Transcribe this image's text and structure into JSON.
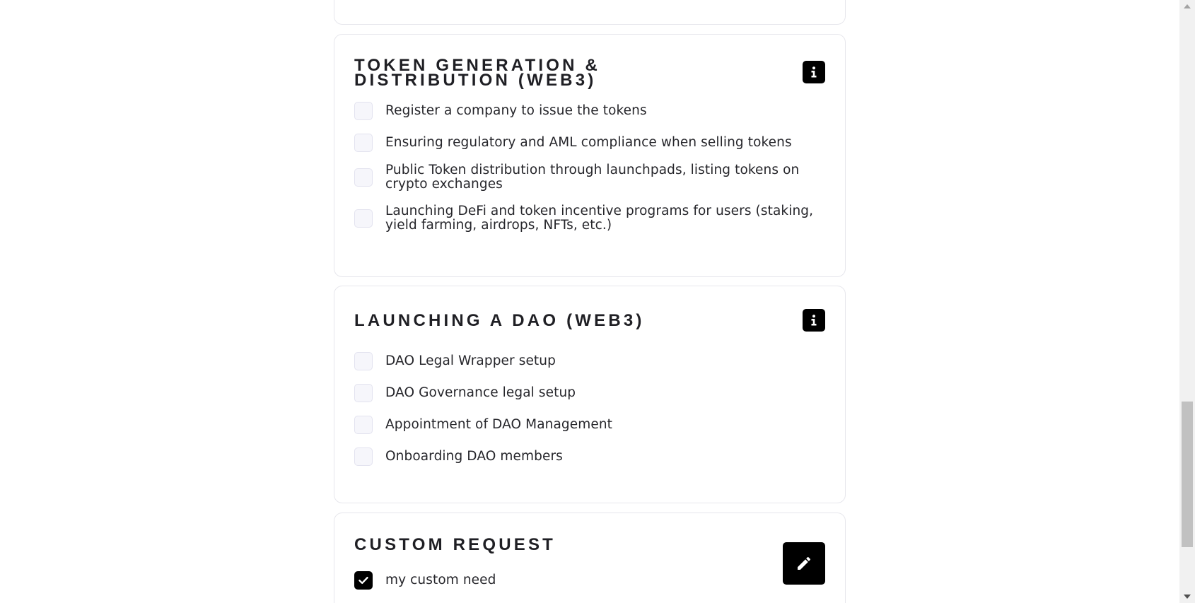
{
  "sections": {
    "token": {
      "title": "TOKEN GENERATION & DISTRIBUTION (WEB3)",
      "info_icon": "info-icon",
      "items": [
        {
          "label": "Register a company to issue the tokens",
          "checked": false
        },
        {
          "label": "Ensuring regulatory and AML compliance when selling tokens",
          "checked": false
        },
        {
          "label": "Public Token distribution through launchpads, listing tokens on crypto exchanges",
          "checked": false
        },
        {
          "label": "Launching DeFi and token incentive programs for users (staking, yield farming, airdrops, NFTs, etc.)",
          "checked": false
        }
      ]
    },
    "dao": {
      "title": "LAUNCHING A DAO (WEB3)",
      "info_icon": "info-icon",
      "items": [
        {
          "label": "DAO Legal Wrapper setup",
          "checked": false
        },
        {
          "label": "DAO Governance legal setup",
          "checked": false
        },
        {
          "label": "Appointment of DAO Management",
          "checked": false
        },
        {
          "label": "Onboarding DAO members",
          "checked": false
        }
      ]
    },
    "custom": {
      "title": "CUSTOM REQUEST",
      "edit_icon": "pencil-icon",
      "items": [
        {
          "label": "my custom need",
          "checked": true
        }
      ]
    }
  },
  "colors": {
    "accent": "#000000",
    "border": "#e6e6ec",
    "checkbox_bg": "#f6f6fb",
    "text": "#26262b"
  }
}
